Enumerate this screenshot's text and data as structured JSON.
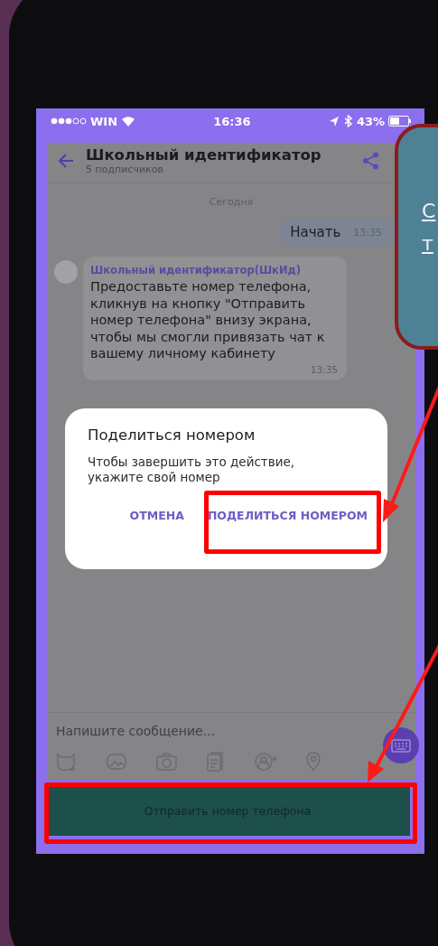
{
  "status_bar": {
    "carrier": "WIN",
    "time": "16:36",
    "battery": "43%"
  },
  "chat_header": {
    "title": "Школьный идентификатор",
    "subtitle": "5 подписчиков"
  },
  "date_divider": "Сегодня",
  "messages": [
    {
      "kind": "outgoing",
      "text": "Начать",
      "time": "13:35"
    },
    {
      "kind": "incoming",
      "sender": "Школьный идентификатор(ШкИд)",
      "text": "Предоставьте номер телефона, кликнув на кнопку \"Отправить номер телефона\" внизу экрана, чтобы мы смогли привязать чат к вашему личному кабинету",
      "time": "13:35"
    }
  ],
  "dialog": {
    "title": "Поделиться номером",
    "text": "Чтобы завершить это действие, укажите свой номер",
    "buttons": [
      {
        "label": "ОТМЕНА",
        "highlighted": false
      },
      {
        "label": "ПОДЕЛИТЬСЯ НОМЕРОМ",
        "highlighted": true
      }
    ]
  },
  "composer": {
    "placeholder": "Напишите сообщение..."
  },
  "reply_button": {
    "label": "Отправить номер телефона",
    "highlighted": true
  },
  "callout": {
    "lines": [
      "С",
      "т"
    ]
  }
}
